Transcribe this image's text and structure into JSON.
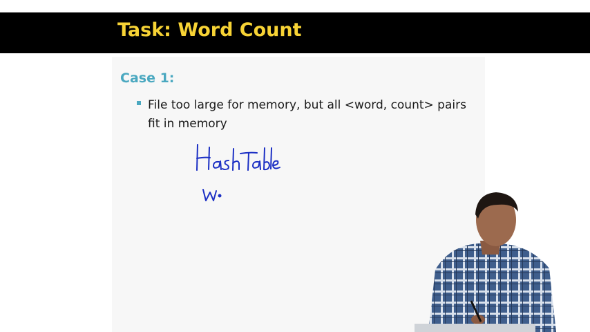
{
  "slide": {
    "title": "Task: Word Count",
    "case_heading": "Case 1:",
    "bullets": [
      "File too large for memory, but all <word, count> pairs fit in memory"
    ],
    "handwritten_notes": [
      "HashTable",
      "W"
    ]
  },
  "colors": {
    "title_bar": "#000000",
    "title_text": "#f7d335",
    "case_heading": "#4aa8c0",
    "bullet_marker": "#4aa8c0",
    "ink": "#1b2fc4"
  }
}
